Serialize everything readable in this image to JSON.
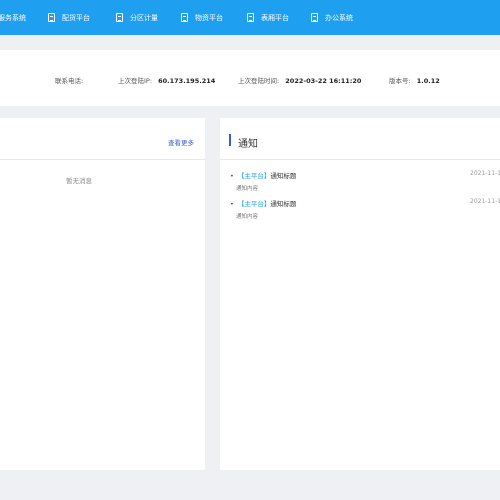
{
  "nav": {
    "items": [
      {
        "label": "服务系统"
      },
      {
        "label": "配货平台"
      },
      {
        "label": "分区计量"
      },
      {
        "label": "物资平台"
      },
      {
        "label": "表厢平台"
      },
      {
        "label": "办公系统"
      }
    ]
  },
  "info": {
    "contact_label": "联系电话:",
    "contact_value": "",
    "last_ip_label": "上次登陆IP:",
    "last_ip_value": "60.173.195.214",
    "last_time_label": "上次登陆时间:",
    "last_time_value": "2022-03-22 16:11:20",
    "version_label": "版本号:",
    "version_value": "1.0.12"
  },
  "left_panel": {
    "more_label": "查看更多",
    "empty_text": "暂无消息"
  },
  "notice_panel": {
    "title": "通知",
    "items": [
      {
        "tag": "【主平台】",
        "title": "通知标题",
        "content": "通知内容",
        "date": "2021-11-1"
      },
      {
        "tag": "【主平台】",
        "title": "通知标题",
        "content": "通知内容",
        "date": "2021-11-1"
      }
    ]
  },
  "colors": {
    "nav_bg": "#1f9ff0",
    "accent": "#3b5bd6",
    "page_bg": "#eef0f4"
  }
}
